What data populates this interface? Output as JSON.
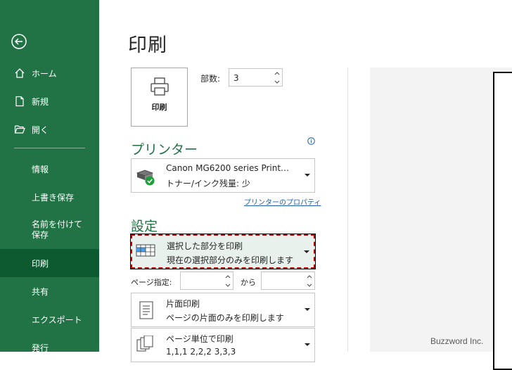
{
  "sidebar": {
    "items": [
      {
        "label": "ホーム",
        "icon": "home-icon"
      },
      {
        "label": "新規",
        "icon": "new-document-icon"
      },
      {
        "label": "開く",
        "icon": "open-folder-icon"
      },
      {
        "label": "情報"
      },
      {
        "label": "上書き保存"
      },
      {
        "label": "名前を付けて保存"
      },
      {
        "label": "印刷"
      },
      {
        "label": "共有"
      },
      {
        "label": "エクスポート"
      },
      {
        "label": "発行"
      }
    ],
    "active_item": "印刷",
    "colors": {
      "background": "#217346",
      "active": "#0e5a30"
    }
  },
  "page": {
    "title": "印刷",
    "print_button_label": "印刷",
    "copies_label": "部数:",
    "copies_value": "3"
  },
  "printer": {
    "section_title": "プリンター",
    "name": "Canon MG6200 series Print…",
    "status": "トナー/インク残量: 少",
    "properties_link": "プリンターのプロパティ"
  },
  "settings": {
    "section_title": "設定",
    "print_what": {
      "main": "選択した部分を印刷",
      "sub": "現在の選択部分のみを印刷します"
    },
    "pages_label": "ページ指定:",
    "pages_from": "",
    "pages_to_label": "から",
    "pages_to": "",
    "sides": {
      "main": "片面印刷",
      "sub": "ページの片面のみを印刷します"
    },
    "collate": {
      "main": "ページ単位で印刷",
      "sub": "1,1,1    2,2,2    3,3,3"
    }
  },
  "watermark": "Buzzword Inc.",
  "accent_color": "#217346"
}
